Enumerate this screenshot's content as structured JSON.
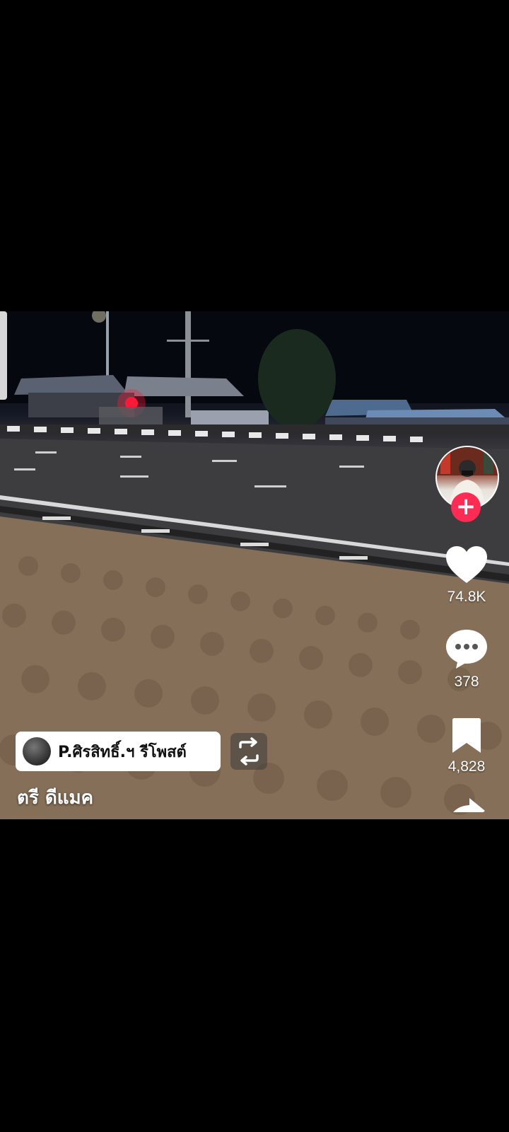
{
  "repost": {
    "username": "P.ศิรสิทธิ์.ฯ",
    "label": "รีโพสต์"
  },
  "caption": "ตรี ดีแมค",
  "actions": {
    "likes": "74.8K",
    "comments": "378",
    "bookmarks": "4,828"
  },
  "icons": {
    "follow": "plus-icon",
    "like": "heart-icon",
    "comment": "comment-bubble-icon",
    "bookmark": "bookmark-icon",
    "share": "share-arrow-icon",
    "repost": "repost-icon"
  },
  "colors": {
    "follow_button": "#fe2c55",
    "background": "#000000"
  }
}
